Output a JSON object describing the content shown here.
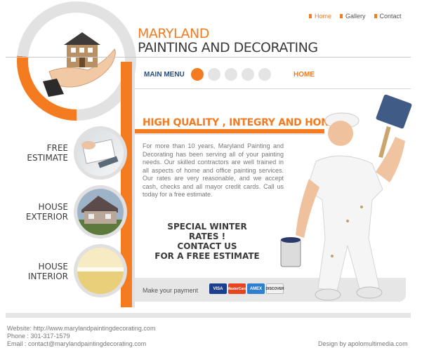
{
  "nav": {
    "items": [
      "Home",
      "Gallery",
      "Contact"
    ]
  },
  "brand": {
    "line1": "MARYLAND",
    "line2": "PAINTING AND DECORATING"
  },
  "menu": {
    "label": "MAIN MENU",
    "current": "HOME"
  },
  "headline": "HIGH QUALITY , INTEGRY AND HONESTY",
  "body": "For more than 10 years, Maryland Painting and Decorating has been serving all of your painting needs. Our skilled contractors are well trained in all aspects of home and office painting services. Our rates are very reasonable, and we accept cash, checks and all mayor credit cards. Call us today for a free estimate.",
  "special": {
    "line1": "SPECIAL WINTER RATES !",
    "line2": "CONTACT US",
    "line3": "FOR A FREE ESTIMATE"
  },
  "payment": {
    "label": "Make your payment",
    "cards": [
      "VISA",
      "MasterCard",
      "AMEX",
      "DISCOVER"
    ]
  },
  "side": [
    {
      "line1": "FREE",
      "line2": "ESTIMATE"
    },
    {
      "line1": "HOUSE",
      "line2": "EXTERIOR"
    },
    {
      "line1": "HOUSE",
      "line2": "INTERIOR"
    }
  ],
  "footer": {
    "website": "Website: http://www.marylandpaintingdecorating.com",
    "phone": "Phone : 301-317-1579",
    "email": "Email : contact@marylandpaintingdecorating.com",
    "design": "Design by apolomultimedia.com"
  },
  "colors": {
    "accent": "#f47b20",
    "navy": "#2a4d7c"
  }
}
